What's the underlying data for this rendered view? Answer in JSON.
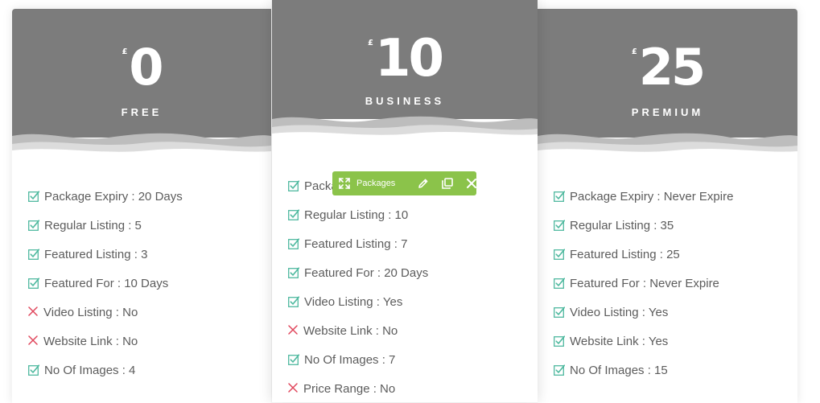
{
  "colors": {
    "header_bg": "#7c7c7c",
    "check": "#4fb99f",
    "cross": "#e0465c",
    "toolbar_bg": "#8bc34a"
  },
  "packages": [
    {
      "currency": "£",
      "price": "0",
      "plan": "FREE",
      "features": [
        {
          "ok": true,
          "text": "Package Expiry : 20 Days"
        },
        {
          "ok": true,
          "text": "Regular Listing : 5"
        },
        {
          "ok": true,
          "text": "Featured Listing : 3"
        },
        {
          "ok": true,
          "text": "Featured For : 10 Days"
        },
        {
          "ok": false,
          "text": "Video Listing : No"
        },
        {
          "ok": false,
          "text": "Website Link : No"
        },
        {
          "ok": true,
          "text": "No Of Images : 4"
        }
      ]
    },
    {
      "currency": "£",
      "price": "10",
      "plan": "BUSINESS",
      "features": [
        {
          "ok": true,
          "text": "Package Expiry : 30 Days"
        },
        {
          "ok": true,
          "text": "Regular Listing : 10"
        },
        {
          "ok": true,
          "text": "Featured Listing : 7"
        },
        {
          "ok": true,
          "text": "Featured For : 20 Days"
        },
        {
          "ok": true,
          "text": "Video Listing : Yes"
        },
        {
          "ok": false,
          "text": "Website Link : No"
        },
        {
          "ok": true,
          "text": "No Of Images : 7"
        },
        {
          "ok": false,
          "text": "Price Range : No"
        }
      ]
    },
    {
      "currency": "£",
      "price": "25",
      "plan": "PREMIUM",
      "features": [
        {
          "ok": true,
          "text": "Package Expiry : Never Expire"
        },
        {
          "ok": true,
          "text": "Regular Listing : 35"
        },
        {
          "ok": true,
          "text": "Featured Listing : 25"
        },
        {
          "ok": true,
          "text": "Featured For : Never Expire"
        },
        {
          "ok": true,
          "text": "Video Listing : Yes"
        },
        {
          "ok": true,
          "text": "Website Link : Yes"
        },
        {
          "ok": true,
          "text": "No Of Images : 15"
        }
      ]
    }
  ],
  "toolbar": {
    "label": "Packages",
    "icons": [
      "move-icon",
      "pencil-icon",
      "duplicate-icon",
      "close-icon"
    ]
  }
}
